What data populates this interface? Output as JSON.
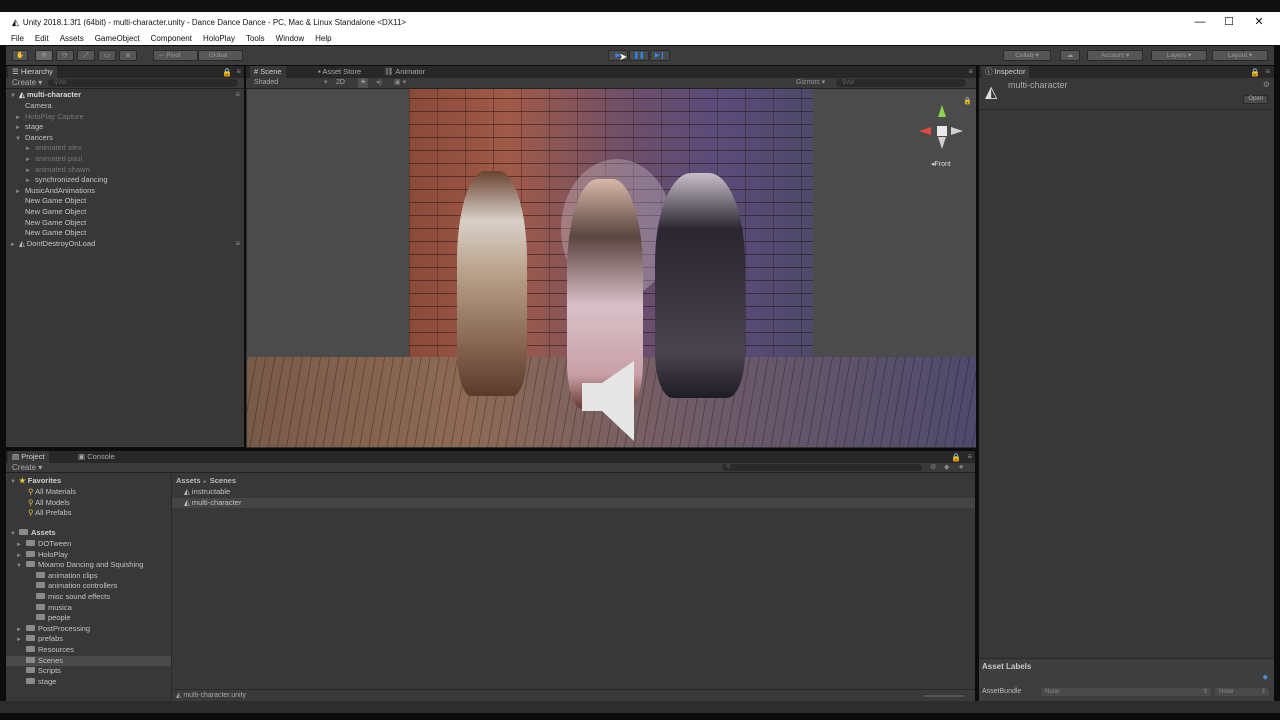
{
  "window": {
    "title": "Unity 2018.1.3f1 (64bit) - multi-character.unity - Dance Dance Dance - PC, Mac & Linux Standalone <DX11>",
    "controls": {
      "minimize": "—",
      "maximize": "☐",
      "close": "✕"
    }
  },
  "menu": [
    "File",
    "Edit",
    "Assets",
    "GameObject",
    "Component",
    "HoloPlay",
    "Tools",
    "Window",
    "Help"
  ],
  "toolbar": {
    "pivot": "Pivot",
    "global": "Global",
    "collab": "Collab",
    "account": "Account",
    "layers": "Layers",
    "layout": "Layout",
    "play_accent": "#2a8cff"
  },
  "hierarchy": {
    "tab": "Hierarchy",
    "create": "Create",
    "search_placeholder": "All",
    "scene": "multi-character",
    "items": [
      {
        "label": "Camera",
        "indent": 1,
        "state": "normal",
        "arrow": ""
      },
      {
        "label": "HoloPlay Capture",
        "indent": 1,
        "state": "dim",
        "arrow": "►"
      },
      {
        "label": "stage",
        "indent": 1,
        "state": "normal",
        "arrow": "►"
      },
      {
        "label": "Dancers",
        "indent": 1,
        "state": "normal",
        "arrow": "▼"
      },
      {
        "label": "animated alex",
        "indent": 2,
        "state": "dim",
        "arrow": "►"
      },
      {
        "label": "animated paul",
        "indent": 2,
        "state": "dim",
        "arrow": "►"
      },
      {
        "label": "animated shawn",
        "indent": 2,
        "state": "dim",
        "arrow": "►"
      },
      {
        "label": "synchronized dancing",
        "indent": 2,
        "state": "normal",
        "arrow": "►"
      },
      {
        "label": "MusicAndAnimations",
        "indent": 1,
        "state": "normal",
        "arrow": "►"
      },
      {
        "label": "New Game Object",
        "indent": 1,
        "state": "normal",
        "arrow": ""
      },
      {
        "label": "New Game Object",
        "indent": 1,
        "state": "normal",
        "arrow": ""
      },
      {
        "label": "New Game Object",
        "indent": 1,
        "state": "normal",
        "arrow": ""
      },
      {
        "label": "New Game Object",
        "indent": 1,
        "state": "normal",
        "arrow": ""
      }
    ],
    "dontdestroy": "DontDestroyOnLoad"
  },
  "scene": {
    "tabs": [
      "Scene",
      "Asset Store",
      "Animator"
    ],
    "shading": "Shaded",
    "mode_2d": "2D",
    "gizmos": "Gizmos",
    "search_placeholder": "All",
    "view_label": "Front"
  },
  "project": {
    "tabs": [
      "Project",
      "Console"
    ],
    "create": "Create",
    "favorites": "Favorites",
    "favorite_items": [
      "All Materials",
      "All Models",
      "All Prefabs"
    ],
    "assets": "Assets",
    "folders": [
      {
        "label": "DOTween",
        "indent": 1,
        "arrow": "►"
      },
      {
        "label": "HoloPlay",
        "indent": 1,
        "arrow": "►"
      },
      {
        "label": "Mixamo Dancing and Squishing",
        "indent": 1,
        "arrow": "▼"
      },
      {
        "label": "animation clips",
        "indent": 2,
        "arrow": ""
      },
      {
        "label": "animation controllers",
        "indent": 2,
        "arrow": ""
      },
      {
        "label": "misc sound effects",
        "indent": 2,
        "arrow": ""
      },
      {
        "label": "musica",
        "indent": 2,
        "arrow": ""
      },
      {
        "label": "people",
        "indent": 2,
        "arrow": ""
      },
      {
        "label": "PostProcessing",
        "indent": 1,
        "arrow": "►"
      },
      {
        "label": "prefabs",
        "indent": 1,
        "arrow": "►"
      },
      {
        "label": "Resources",
        "indent": 1,
        "arrow": ""
      },
      {
        "label": "Scenes",
        "indent": 1,
        "arrow": "",
        "selected": true
      },
      {
        "label": "Scripts",
        "indent": 1,
        "arrow": ""
      },
      {
        "label": "stage",
        "indent": 1,
        "arrow": ""
      }
    ],
    "breadcrumb_root": "Assets",
    "breadcrumb_sep": "►",
    "breadcrumb_current": "Scenes",
    "files": [
      "instructable",
      "multi-character"
    ],
    "selected_path": "multi-character.unity"
  },
  "inspector": {
    "tab": "Inspector",
    "object_name": "multi-character",
    "open_button": "Open",
    "asset_labels": "Asset Labels",
    "assetbundle_label": "AssetBundle",
    "assetbundle_value": "None",
    "variant_value": "None"
  }
}
